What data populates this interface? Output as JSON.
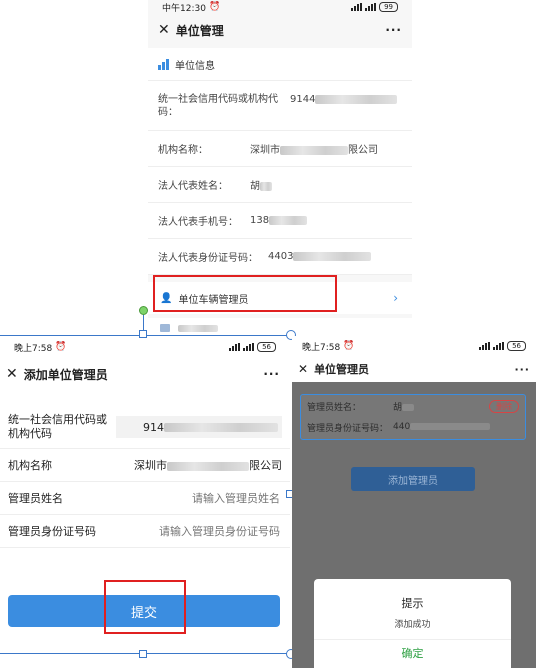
{
  "top": {
    "status_time": "中午12:30",
    "battery": "99",
    "title": "单位管理",
    "more": "···",
    "section_title": "单位信息",
    "credit_label": "统一社会信用代码或机构代码：",
    "credit_value": "9144",
    "org_label": "机构名称：",
    "org_value_prefix": "深圳市",
    "org_value_suffix": "限公司",
    "legal_name_label": "法人代表姓名：",
    "legal_name_value": "胡",
    "legal_phone_label": "法人代表手机号：",
    "legal_phone_value": "138",
    "legal_id_label": "法人代表身份证号码：",
    "legal_id_value": "4403",
    "vehicle_manager_item": "单位车辆管理员"
  },
  "left": {
    "status_time": "晚上7:58",
    "battery": "56",
    "title": "添加单位管理员",
    "more": "···",
    "credit_label": "统一社会信用代码或机构代码",
    "credit_value": "914",
    "org_label": "机构名称",
    "org_value_prefix": "深圳市",
    "org_value_suffix": "限公司",
    "admin_name_label": "管理员姓名",
    "admin_name_placeholder": "请输入管理员姓名",
    "admin_id_label": "管理员身份证号码",
    "admin_id_placeholder": "请输入管理员身份证号码",
    "submit": "提交"
  },
  "right": {
    "status_time": "晚上7:58",
    "battery": "56",
    "title": "单位管理员",
    "more": "···",
    "card_name_label": "管理员姓名：",
    "card_name_value": "胡",
    "card_delete": "删除",
    "card_id_label": "管理员身份证号码：",
    "card_id_value": "440",
    "add_admin_button": "添加管理员",
    "dialog_title": "提示",
    "dialog_message": "添加成功",
    "dialog_confirm": "确定"
  },
  "colors": {
    "primary_blue": "#3b8de0",
    "highlight_red": "#e02020",
    "confirm_green": "#2ea043",
    "delete_red": "#d64545",
    "overlay": "#6f6f6f"
  }
}
